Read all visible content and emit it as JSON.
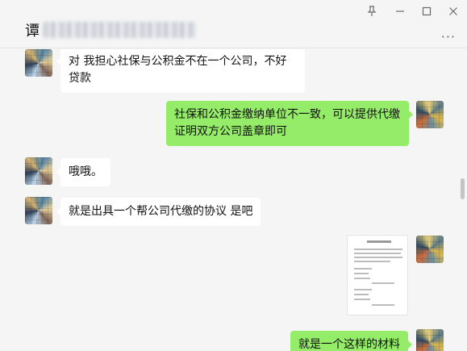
{
  "header": {
    "title_char": "谭",
    "more_label": "···"
  },
  "window_controls": {
    "pin_icon": "pin-icon",
    "minimize_icon": "minimize-icon",
    "maximize_icon": "maximize-icon",
    "close_icon": "close-icon"
  },
  "messages": [
    {
      "sender": "contact",
      "text": "对 我担心社保与公积金不在一个公司，不好贷款"
    },
    {
      "sender": "me",
      "text": "社保和公积金缴纳单位不一致，可以提供代缴证明双方公司盖章即可"
    },
    {
      "sender": "contact",
      "text": "哦哦。"
    },
    {
      "sender": "contact",
      "text": "就是出具一个帮公司代缴的协议 是吧"
    },
    {
      "sender": "me",
      "type": "image",
      "content": "document-photo"
    },
    {
      "sender": "me",
      "text": "就是一个这样的材料"
    }
  ],
  "colors": {
    "outgoing_bubble": "#95ec69",
    "incoming_bubble": "#ffffff",
    "chat_background": "#f5f5f5"
  }
}
